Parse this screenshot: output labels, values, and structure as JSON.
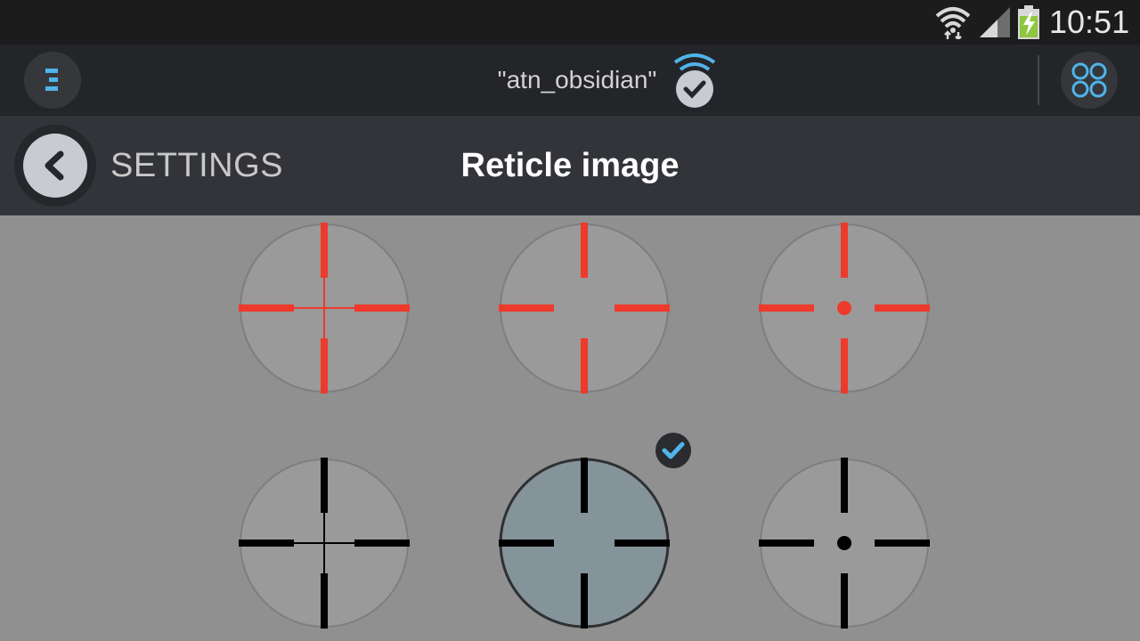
{
  "status_bar": {
    "time": "10:51",
    "wifi_icon": "wifi-icon",
    "signal_icon": "signal-icon",
    "battery_icon": "battery-charging-icon"
  },
  "app_bar": {
    "menu_icon": "menu-icon",
    "device_name": "\"atn_obsidian\"",
    "connection_icon": "wifi-connected-check-icon",
    "apps_icon": "apps-grid-icon"
  },
  "nav_bar": {
    "back_icon": "back-chevron-icon",
    "back_label": "SETTINGS",
    "title": "Reticle image"
  },
  "reticles": [
    {
      "color": "#ee3a2c",
      "style": "thin-center",
      "selected": false
    },
    {
      "color": "#ee3a2c",
      "style": "open-center",
      "selected": false
    },
    {
      "color": "#ee3a2c",
      "style": "dot-center",
      "selected": false
    },
    {
      "color": "#000000",
      "style": "thin-center",
      "selected": false
    },
    {
      "color": "#000000",
      "style": "open-center",
      "selected": true
    },
    {
      "color": "#000000",
      "style": "dot-center",
      "selected": false
    }
  ],
  "colors": {
    "accent": "#4fb4ea",
    "background": "#909090",
    "selected_fill": "#85939a"
  }
}
